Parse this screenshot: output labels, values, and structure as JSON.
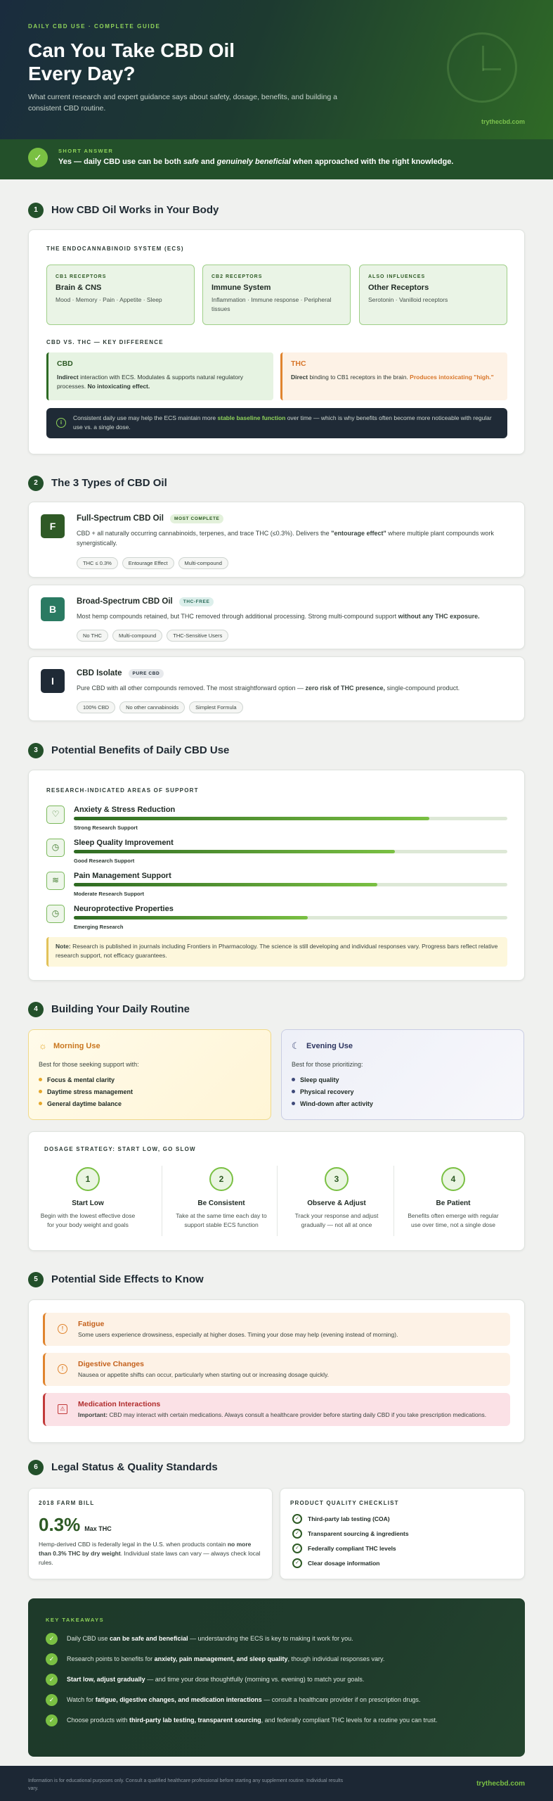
{
  "hero": {
    "kicker": "DAILY CBD USE · COMPLETE GUIDE",
    "title_l1": "Can You Take CBD Oil",
    "title_l2": "Every Day?",
    "subtitle": "What current research and expert guidance says about safety, dosage, benefits, and building a consistent CBD routine.",
    "site": "trythecbd.com"
  },
  "answer": {
    "label": "SHORT ANSWER",
    "pre": "Yes — daily CBD use can be both ",
    "em1": "safe",
    "mid": " and ",
    "em2": "genuinely beneficial",
    "post": " when approached with the right knowledge."
  },
  "s1": {
    "num": "1",
    "title": "How CBD Oil Works in Your Body",
    "ecs": "THE ENDOCANNABINOID SYSTEM (ECS)",
    "receptors": [
      {
        "a": "CB1 RECEPTORS",
        "b": "Brain & CNS",
        "c": "Mood · Memory · Pain · Appetite · Sleep"
      },
      {
        "a": "CB2 RECEPTORS",
        "b": "Immune System",
        "c": "Inflammation · Immune response · Peripheral tissues"
      },
      {
        "a": "ALSO INFLUENCES",
        "b": "Other Receptors",
        "c": "Serotonin · Vanilloid receptors"
      }
    ],
    "vs": "CBD VS. THC — KEY DIFFERENCE",
    "cbd": {
      "h": "CBD",
      "b1": "Indirect",
      "t1": " interaction with ECS. Modulates & supports natural regulatory processes. ",
      "b2": "No intoxicating effect."
    },
    "thc": {
      "h": "THC",
      "b1": "Direct",
      "t1": " binding to CB1 receptors in the brain. ",
      "b2": "Produces intoxicating \"high.\""
    },
    "note": {
      "t1": "Consistent daily use may help the ECS maintain more ",
      "g": "stable baseline function",
      "t2": " over time — which is why benefits often become more noticeable with regular use vs. a single dose."
    }
  },
  "s2": {
    "num": "2",
    "title": "The 3 Types of CBD Oil",
    "types": [
      {
        "icon": "F",
        "name": "Full-Spectrum CBD Oil",
        "badge": "MOST COMPLETE",
        "d1": "CBD + all naturally occurring cannabinoids, terpenes, and trace THC (≤0.3%). Delivers the ",
        "db": "\"entourage effect\"",
        "d2": " where multiple plant compounds work synergistically.",
        "tags": [
          "THC ≤ 0.3%",
          "Entourage Effect",
          "Multi-compound"
        ]
      },
      {
        "icon": "B",
        "name": "Broad-Spectrum CBD Oil",
        "badge": "THC-FREE",
        "d1": "Most hemp compounds retained, but THC removed through additional processing. Strong multi-compound support ",
        "db": "without any THC exposure.",
        "d2": "",
        "tags": [
          "No THC",
          "Multi-compound",
          "THC-Sensitive Users"
        ]
      },
      {
        "icon": "I",
        "name": "CBD Isolate",
        "badge": "PURE CBD",
        "d1": "Pure CBD with all other compounds removed. The most straightforward option — ",
        "db": "zero risk of THC presence,",
        "d2": " single-compound product.",
        "tags": [
          "100% CBD",
          "No other cannabinoids",
          "Simplest Formula"
        ]
      }
    ]
  },
  "s3": {
    "num": "3",
    "title": "Potential Benefits of Daily CBD Use",
    "ov": "RESEARCH-INDICATED AREAS OF SUPPORT",
    "benefits": [
      {
        "icon": "heart-icon",
        "name": "Anxiety & Stress Reduction",
        "level": 0.82,
        "label": "Strong Research Support"
      },
      {
        "icon": "clock-icon",
        "name": "Sleep Quality Improvement",
        "level": 0.74,
        "label": "Good Research Support"
      },
      {
        "icon": "layers-icon",
        "name": "Pain Management Support",
        "level": 0.7,
        "label": "Moderate Research Support"
      },
      {
        "icon": "clock-icon",
        "name": "Neuroprotective Properties",
        "level": 0.54,
        "label": "Emerging Research"
      }
    ],
    "note": {
      "b": "Note:",
      "t": " Research is published in journals including Frontiers in Pharmacology. The science is still developing and individual responses vary. Progress bars reflect relative research support, not efficacy guarantees."
    }
  },
  "s4": {
    "num": "4",
    "title": "Building Your Daily Routine",
    "morning": {
      "title": "Morning Use",
      "best": "Best for those seeking support with:",
      "items": [
        "Focus & mental clarity",
        "Daytime stress management",
        "General daytime balance"
      ]
    },
    "evening": {
      "title": "Evening Use",
      "best": "Best for those prioritizing:",
      "items": [
        "Sleep quality",
        "Physical recovery",
        "Wind-down after activity"
      ]
    },
    "dosage": "DOSAGE STRATEGY: START LOW, GO SLOW",
    "steps": [
      {
        "n": "1",
        "t": "Start Low",
        "d": "Begin with the lowest effective dose for your body weight and goals"
      },
      {
        "n": "2",
        "t": "Be Consistent",
        "d": "Take at the same time each day to support stable ECS function"
      },
      {
        "n": "3",
        "t": "Observe & Adjust",
        "d": "Track your response and adjust gradually — not all at once"
      },
      {
        "n": "4",
        "t": "Be Patient",
        "d": "Benefits often emerge with regular use over time, not a single dose"
      }
    ]
  },
  "s5": {
    "num": "5",
    "title": "Potential Side Effects to Know",
    "effects": [
      {
        "t": "Fatigue",
        "d": "Some users experience drowsiness, especially at higher doses. Timing your dose may help (evening instead of morning)."
      },
      {
        "t": "Digestive Changes",
        "d": "Nausea or appetite shifts can occur, particularly when starting out or increasing dosage quickly."
      },
      {
        "t": "Medication Interactions",
        "db": "Important:",
        "d": " CBD may interact with certain medications. Always consult a healthcare provider before starting daily CBD if you take prescription medications."
      }
    ]
  },
  "s6": {
    "num": "6",
    "title": "Legal Status & Quality Standards",
    "farm": {
      "ov": "2018 FARM BILL",
      "big": "0.3%",
      "unit": "Max THC",
      "t1": "Hemp-derived CBD is federally legal in the U.S. when products contain ",
      "b": "no more than 0.3% THC by dry weight",
      "t2": ". Individual state laws can vary — always check local rules."
    },
    "check": {
      "ov": "PRODUCT QUALITY CHECKLIST",
      "items": [
        "Third-party lab testing (COA)",
        "Transparent sourcing & ingredients",
        "Federally compliant THC levels",
        "Clear dosage information"
      ]
    }
  },
  "kt": {
    "ov": "KEY TAKEAWAYS",
    "rows": [
      {
        "a": "Daily CBD use ",
        "b": "can be safe and beneficial",
        "c": " — understanding the ECS is key to making it work for you."
      },
      {
        "a": "Research points to benefits for ",
        "b": "anxiety, pain management, and sleep quality",
        "c": ", though individual responses vary."
      },
      {
        "a": "",
        "b": "Start low, adjust gradually",
        "c": " — and time your dose thoughtfully (morning vs. evening) to match your goals."
      },
      {
        "a": "Watch for ",
        "b": "fatigue, digestive changes, and medication interactions",
        "c": " — consult a healthcare provider if on prescription drugs."
      },
      {
        "a": "Choose products with ",
        "b": "third-party lab testing, transparent sourcing",
        "c": ", and federally compliant THC levels for a routine you can trust."
      }
    ]
  },
  "footer": {
    "d": "Information is for educational purposes only. Consult a qualified healthcare professional before starting any supplement routine. Individual results vary.",
    "site": "trythecbd.com"
  },
  "colors": {
    "brand_green": "#23502a",
    "accent": "#7ac043",
    "thc_orange": "#e0842e",
    "warn_red": "#c23a3a"
  }
}
